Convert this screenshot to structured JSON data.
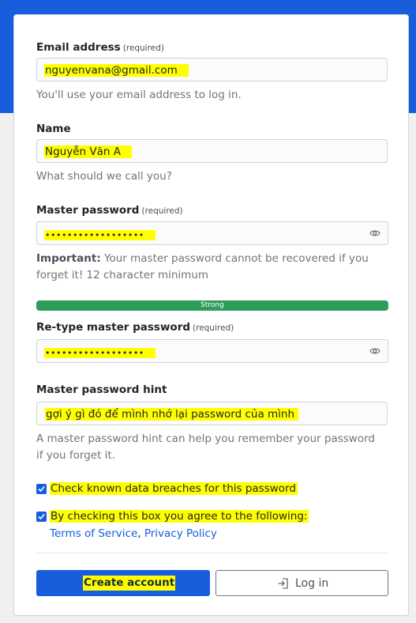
{
  "colors": {
    "brand": "#175ddc",
    "highlight": "#ffff00",
    "strength": "#2e9d5a"
  },
  "email": {
    "label": "Email address",
    "required": "(required)",
    "value": "nguyenvana@gmail.com",
    "help": "You'll use your email address to log in."
  },
  "name": {
    "label": "Name",
    "value": "Nguyễn Văn A",
    "help": "What should we call you?"
  },
  "master_password": {
    "label": "Master password",
    "required": "(required)",
    "value": "••••••••••••••••••",
    "important_label": "Important:",
    "important_text": " Your master password cannot be recovered if you forget it! 12 character minimum",
    "strength": "Strong",
    "strength_fraction": 1.0,
    "toggle_icon": "eye-icon"
  },
  "retype_password": {
    "label": "Re-type master password",
    "required": "(required)",
    "value": "••••••••••••••••••",
    "toggle_icon": "eye-icon"
  },
  "hint": {
    "label": "Master password hint",
    "value": "gợi ý gì đó để mình nhớ lại password của mình",
    "help": "A master password hint can help you remember your password if you forget it."
  },
  "checkboxes": {
    "breach": {
      "label": "Check known data breaches for this password",
      "checked": true
    },
    "terms": {
      "label": "By checking this box you agree to the following:",
      "checked": true,
      "tos_link": "Terms of Service",
      "separator": ", ",
      "privacy_link": "Privacy Policy"
    }
  },
  "actions": {
    "create": "Create account",
    "login": "Log in",
    "login_icon": "sign-in-icon"
  }
}
